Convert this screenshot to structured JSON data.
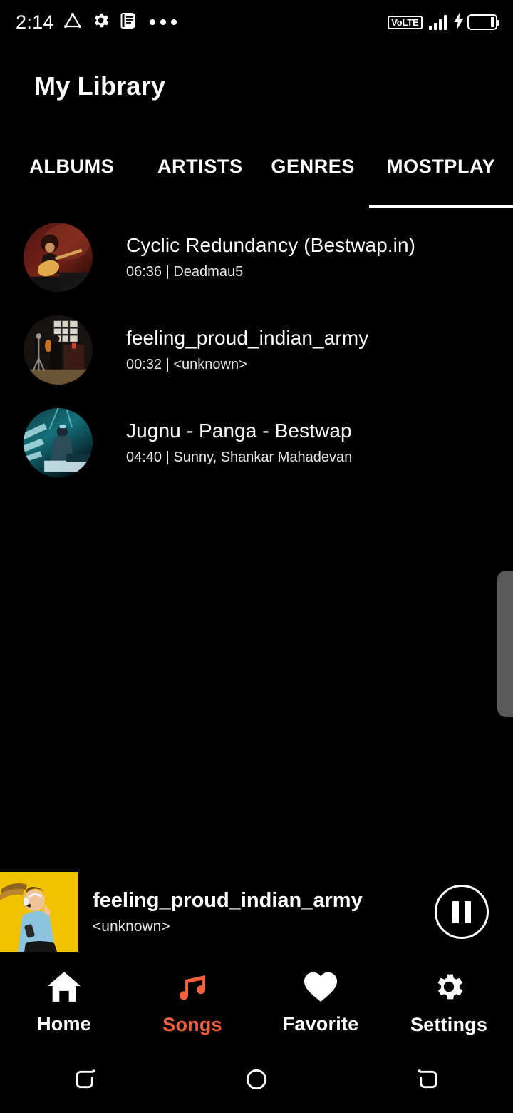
{
  "statusbar": {
    "clock": "2:14",
    "left_icons": [
      "triangle-outline-icon",
      "gear-icon",
      "document-icon",
      "overflow-dots-icon"
    ],
    "network_label": "VoLTE",
    "signal_bars": 4,
    "charging": true,
    "battery_percent": 16
  },
  "header": {
    "title": "My Library"
  },
  "tabs": [
    {
      "label": "ALBUMS",
      "active": false,
      "name": "tab-albums"
    },
    {
      "label": "ARTISTS",
      "active": false,
      "name": "tab-artists"
    },
    {
      "label": "GENRES",
      "active": false,
      "name": "tab-genres"
    },
    {
      "label": "MOSTPLAY",
      "active": true,
      "name": "tab-mostplay"
    }
  ],
  "songs": [
    {
      "title": "Cyclic Redundancy (Bestwap.in)",
      "duration": "06:36",
      "artist": "Deadmau5",
      "subtitle": "06:36 | Deadmau5",
      "art": "guitarist-red-stage"
    },
    {
      "title": "feeling_proud_indian_army",
      "duration": "00:32",
      "artist": "<unknown>",
      "subtitle": "00:32 | <unknown>",
      "art": "dark-studio-window"
    },
    {
      "title": "Jugnu - Panga - Bestwap",
      "duration": "04:40",
      "artist": "Sunny, Shankar Mahadevan",
      "subtitle": "04:40 | Sunny, Shankar Mahadevan",
      "art": "dj-teal-stage"
    }
  ],
  "nowplaying": {
    "title": "feeling_proud_indian_army",
    "artist": "<unknown>",
    "art": "woman-headphones-yellow",
    "transport_state": "playing",
    "transport_icon": "pause-icon"
  },
  "bottomnav": [
    {
      "label": "Home",
      "icon": "home-icon",
      "active": false
    },
    {
      "label": "Songs",
      "icon": "music-note-icon",
      "active": true
    },
    {
      "label": "Favorite",
      "icon": "heart-icon",
      "active": false
    },
    {
      "label": "Settings",
      "icon": "gear-icon",
      "active": false
    }
  ],
  "sysnav": [
    {
      "name": "recents-button"
    },
    {
      "name": "home-button"
    },
    {
      "name": "back-button"
    }
  ],
  "colors": {
    "background": "#000000",
    "accent": "#F5603C",
    "text_primary": "#FFFFFF",
    "text_secondary": "#E8E8E8",
    "scrollbar": "#5A5A5A",
    "nowplaying_art_bg": "#F2C200"
  }
}
